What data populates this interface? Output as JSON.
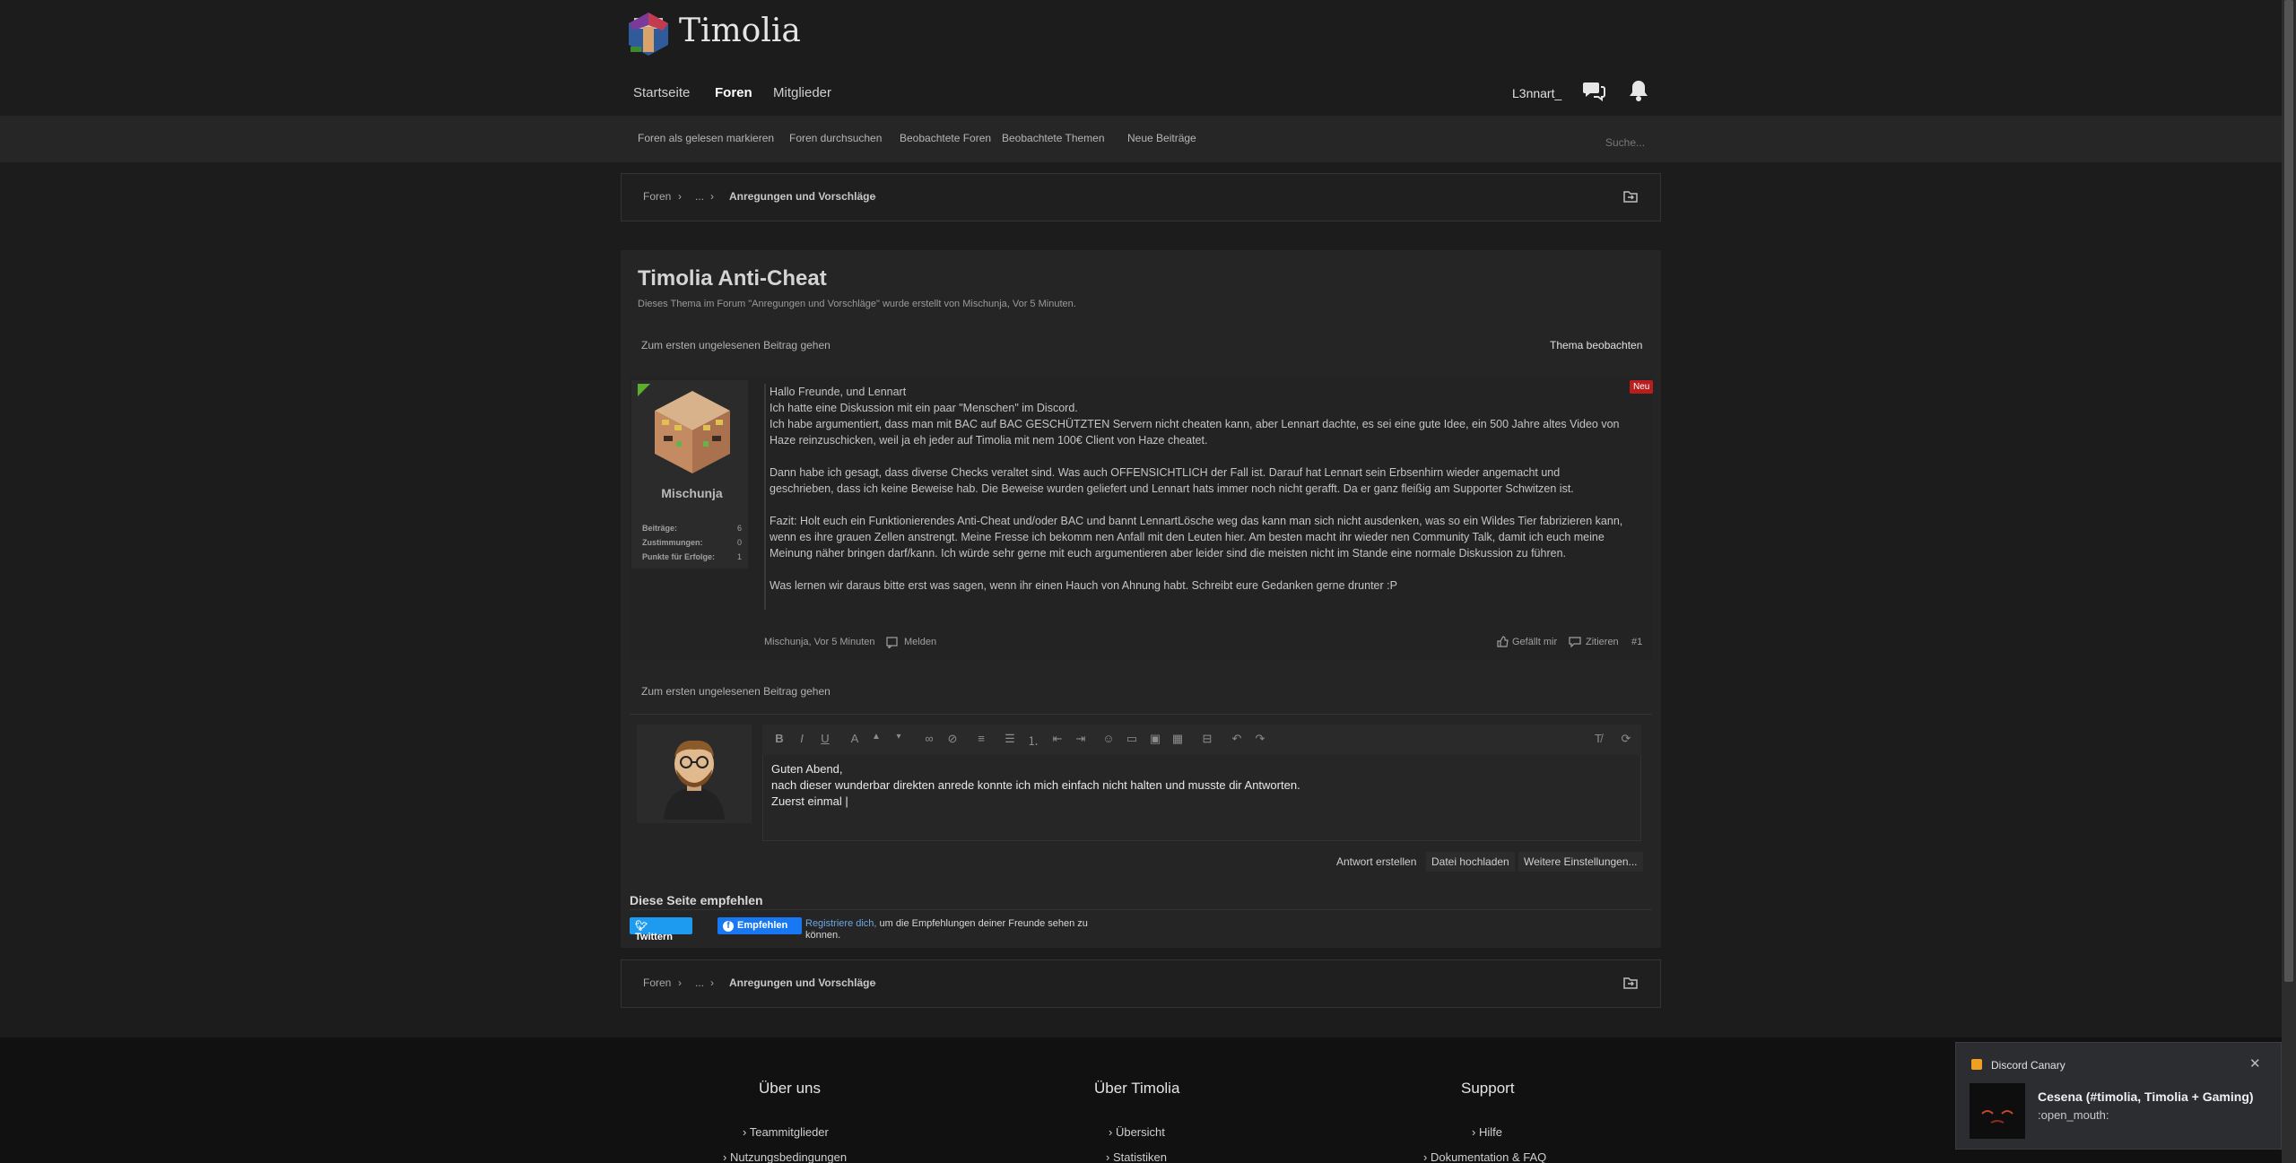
{
  "header": {
    "site_name": "Timolia",
    "nav": [
      "Startseite",
      "Foren",
      "Mitglieder"
    ],
    "username": "L3nnart_"
  },
  "subnav": {
    "links": [
      "Foren als gelesen markieren",
      "Foren durchsuchen",
      "Beobachtete Foren",
      "Beobachtete Themen",
      "Neue Beiträge"
    ],
    "search_placeholder": "Suche..."
  },
  "breadcrumb": {
    "items": [
      "Foren",
      "...",
      "Anregungen und Vorschläge"
    ],
    "sep": "›"
  },
  "thread": {
    "title": "Timolia Anti-Cheat",
    "meta": "Dieses Thema im Forum \"Anregungen und Vorschläge\" wurde erstellt von Mischunja, Vor 5 Minuten.",
    "goto_unread": "Zum ersten ungelesenen Beitrag gehen",
    "watch": "Thema beobachten"
  },
  "post": {
    "author": "Mischunja",
    "badge": "Neu",
    "stats": [
      {
        "label": "Beiträge:",
        "value": "6"
      },
      {
        "label": "Zustimmungen:",
        "value": "0"
      },
      {
        "label": "Punkte für Erfolge:",
        "value": "1"
      }
    ],
    "paragraphs": [
      "Hallo Freunde, und Lennart\nIch hatte eine Diskussion mit ein paar \"Menschen\" im Discord.\nIch habe argumentiert, dass man mit BAC auf BAC GESCHÜTZTEN Servern nicht cheaten kann, aber Lennart dachte, es sei eine gute Idee, ein 500 Jahre altes Video von Haze reinzuschicken, weil ja eh jeder auf Timolia mit nem 100€ Client von Haze cheatet.",
      "Dann habe ich gesagt, dass diverse Checks veraltet sind. Was auch OFFENSICHTLICH der Fall ist. Darauf hat Lennart sein Erbsenhirn wieder angemacht und geschrieben, dass ich keine Beweise hab. Die Beweise wurden geliefert und Lennart hats immer noch nicht gerafft. Da er ganz fleißig am Supporter Schwitzen ist.",
      "Fazit: Holt euch ein Funktionierendes Anti-Cheat und/oder BAC und bannt LennartLösche weg das kann man sich nicht ausdenken, was so ein Wildes Tier fabrizieren kann, wenn es ihre grauen Zellen anstrengt. Meine Fresse ich bekomm nen Anfall mit den Leuten hier. Am besten macht ihr wieder nen Community Talk, damit ich euch meine Meinung näher bringen darf/kann. Ich würde sehr gerne mit euch argumentieren aber leider sind die meisten nicht im Stande eine normale Diskussion zu führen.",
      "Was lernen wir daraus bitte erst was sagen, wenn ihr einen Hauch von Ahnung habt. Schreibt eure Gedanken gerne drunter :P"
    ],
    "footer_author_time": "Mischunja, Vor 5 Minuten",
    "report": "Melden",
    "like": "Gefällt mir",
    "quote": "Zitieren",
    "number": "#1"
  },
  "editor": {
    "lines": [
      "Guten Abend,",
      "nach dieser wunderbar direkten anrede konnte ich mich einfach nicht halten und musste dir Antworten.",
      "Zuerst einmal |"
    ],
    "buttons": [
      "Antwort erstellen",
      "Datei hochladen",
      "Weitere Einstellungen..."
    ]
  },
  "share": {
    "title": "Diese Seite empfehlen",
    "tweet": "Twittern",
    "fb": "Empfehlen",
    "fb_link": "Registriere dich,",
    "fb_text": " um die Empfehlungen deiner Freunde sehen zu können."
  },
  "footer": {
    "cols": [
      {
        "heading": "Über uns",
        "links": [
          "Teammitglieder",
          "Nutzungsbedingungen"
        ]
      },
      {
        "heading": "Über Timolia",
        "links": [
          "Übersicht",
          "Statistiken"
        ]
      },
      {
        "heading": "Support",
        "links": [
          "Hilfe",
          "Dokumentation & FAQ"
        ]
      }
    ]
  },
  "notification": {
    "app": "Discord Canary",
    "title": "Cesena (#timolia, Timolia + Gaming)",
    "message": ":open_mouth:"
  }
}
